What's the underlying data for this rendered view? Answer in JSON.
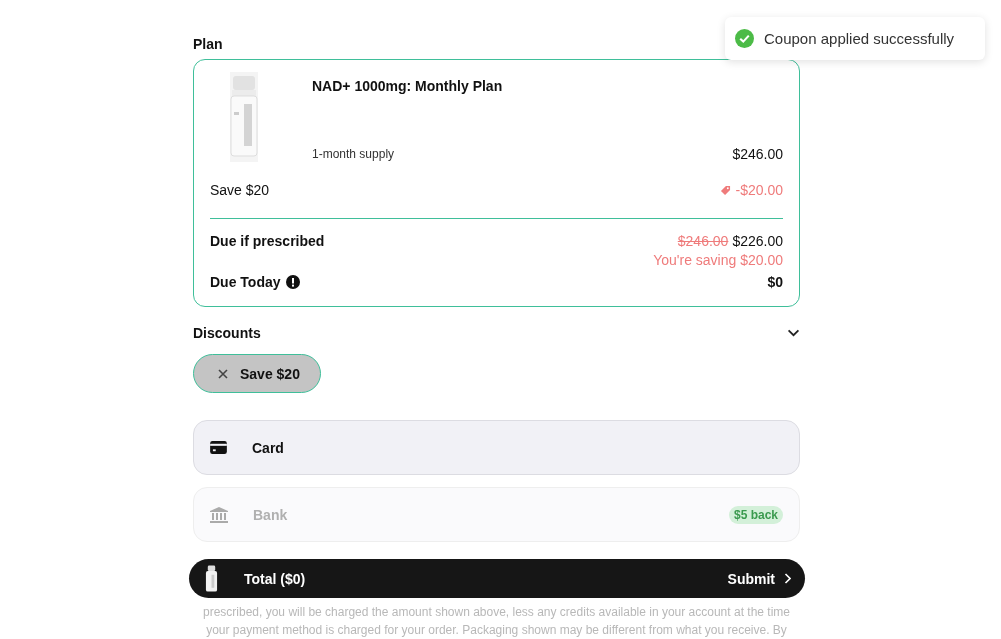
{
  "toast": {
    "message": "Coupon applied successfully"
  },
  "plan": {
    "heading": "Plan",
    "name": "NAD+ 1000mg: Monthly Plan",
    "supply": "1-month supply",
    "price": "$246.00",
    "discount": {
      "label": "Save $20",
      "amount": "-$20.00"
    },
    "due_if_prescribed": {
      "label": "Due if prescribed",
      "original_price": "$246.00",
      "price": "$226.00",
      "saving": "You're saving $20.00"
    },
    "due_today": {
      "label": "Due Today",
      "amount": "$0"
    }
  },
  "discounts": {
    "heading": "Discounts",
    "chips": [
      {
        "label": "Save $20"
      }
    ]
  },
  "payment_methods": [
    {
      "kind": "card",
      "label": "Card",
      "disabled": false
    },
    {
      "kind": "bank",
      "label": "Bank",
      "disabled": true,
      "badge": "$5 back"
    }
  ],
  "footer_bar": {
    "total": "Total ($0)",
    "submit": "Submit"
  },
  "disclaimer_lines": [
    "prescribed, you will be charged the amount shown above, less any credits available in your account at the time",
    "your payment method is charged for your order. Packaging shown may be different from what you receive. By"
  ]
}
